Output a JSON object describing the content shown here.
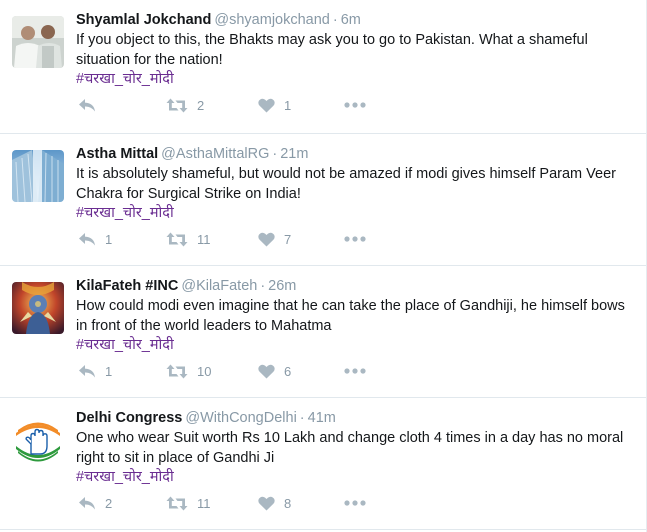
{
  "tweets": [
    {
      "fullname": "Shyamlal Jokchand",
      "username": "@shyamjokchand",
      "time": "6m",
      "text": "If you object to this, the Bhakts may ask you  to go to Pakistan. What a shameful situation for the nation!",
      "hashtag": "#चरखा_चोर_मोदी",
      "replies": "",
      "retweets": "2",
      "likes": "1",
      "avatar": "photo-avatar"
    },
    {
      "fullname": "Astha Mittal",
      "username": "@AsthaMittalRG",
      "time": "21m",
      "text": "It is absolutely shameful, but would not be amazed if modi gives himself Param Veer Chakra for Surgical Strike on India!",
      "hashtag": "#चरखा_चोर_मोदी",
      "replies": "1",
      "retweets": "11",
      "likes": "7",
      "avatar": "building-avatar"
    },
    {
      "fullname": "KilaFateh #INC",
      "username": "@KilaFateh",
      "time": "26m",
      "text": "How could modi even imagine that he can take the place of Gandhiji, he himself bows in front of the world leaders to Mahatma",
      "hashtag": "#चरखा_चोर_मोदी",
      "replies": "1",
      "retweets": "10",
      "likes": "6",
      "avatar": "deity-avatar"
    },
    {
      "fullname": "Delhi Congress",
      "username": "@WithCongDelhi",
      "time": "41m",
      "text": "One who wear Suit worth Rs 10 Lakh and change cloth 4 times in a day has no moral right to sit in place of Gandhi Ji",
      "hashtag": "#चरखा_चोर_मोदी",
      "replies": "2",
      "retweets": "11",
      "likes": "8",
      "avatar": "congress-hand-avatar"
    }
  ],
  "separator": "·",
  "colors": {
    "name": "#14171a",
    "meta": "#8899a6",
    "hashtag": "#6a2d91",
    "icon": "#aab8c2",
    "divider": "#e1e8ed"
  },
  "icons": [
    "reply-icon",
    "retweet-icon",
    "heart-icon",
    "more-icon"
  ]
}
